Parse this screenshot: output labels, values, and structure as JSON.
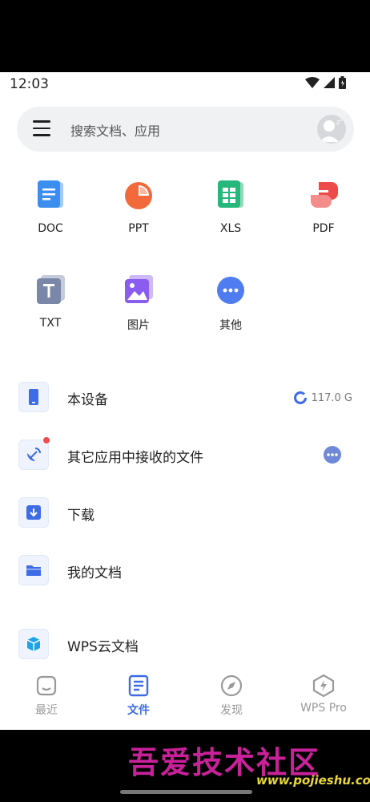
{
  "status": {
    "time": "12:03"
  },
  "search": {
    "placeholder": "搜索文档、应用"
  },
  "categories": [
    {
      "label": "DOC",
      "icon": "doc-icon",
      "color": "#3b8ef0"
    },
    {
      "label": "PPT",
      "icon": "ppt-icon",
      "color": "#f26a3c"
    },
    {
      "label": "XLS",
      "icon": "xls-icon",
      "color": "#25b77c"
    },
    {
      "label": "PDF",
      "icon": "pdf-icon",
      "color": "#ef4a4a"
    },
    {
      "label": "TXT",
      "icon": "txt-icon",
      "color": "#7a87a8"
    },
    {
      "label": "图片",
      "icon": "image-icon",
      "color": "#8b5cf0"
    },
    {
      "label": "其他",
      "icon": "more-icon",
      "color": "#4f7cf0"
    }
  ],
  "list": [
    {
      "label": "本设备",
      "icon": "phone-icon",
      "extra": "117.0 G"
    },
    {
      "label": "其它应用中接收的文件",
      "icon": "satellite-icon"
    },
    {
      "label": "下载",
      "icon": "download-icon"
    },
    {
      "label": "我的文档",
      "icon": "folder-icon"
    },
    {
      "label": "WPS云文档",
      "icon": "cloud-cube-icon"
    }
  ],
  "nav": [
    {
      "label": "最近",
      "active": false
    },
    {
      "label": "文件",
      "active": true
    },
    {
      "label": "发现",
      "active": false
    },
    {
      "label": "WPS Pro",
      "active": false
    }
  ],
  "colors": {
    "accent": "#3e6ce6",
    "watermark": "#c8219a"
  },
  "watermark": {
    "title": "吾爱技术社区",
    "url": "www.pojieshu.com"
  }
}
